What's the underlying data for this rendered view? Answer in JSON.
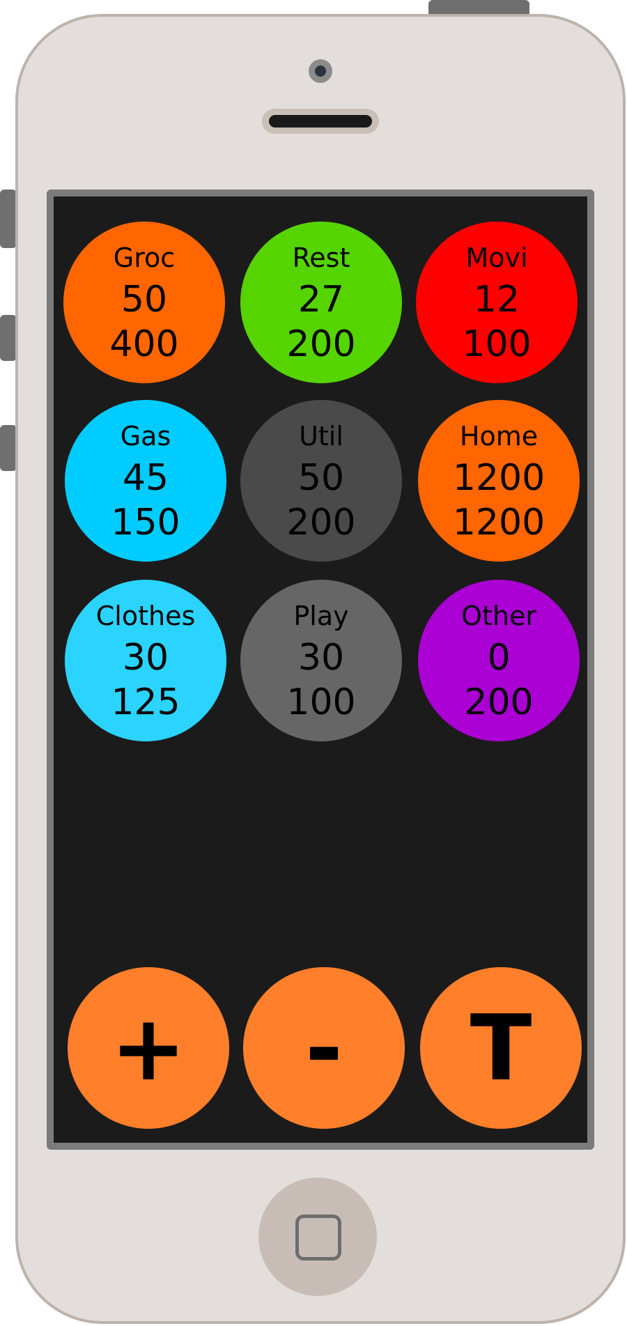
{
  "categories": [
    {
      "label": "Groc",
      "spent": "50",
      "budget": "400",
      "color": "#ff6600"
    },
    {
      "label": "Rest",
      "spent": "27",
      "budget": "200",
      "color": "#55d400"
    },
    {
      "label": "Movi",
      "spent": "12",
      "budget": "100",
      "color": "#ff0000"
    },
    {
      "label": "Gas",
      "spent": "45",
      "budget": "150",
      "color": "#00ccff"
    },
    {
      "label": "Util",
      "spent": "50",
      "budget": "200",
      "color": "#4a4a4a"
    },
    {
      "label": "Home",
      "spent": "1200",
      "budget": "1200",
      "color": "#ff6600"
    },
    {
      "label": "Clothes",
      "spent": "30",
      "budget": "125",
      "color": "#2ad4ff"
    },
    {
      "label": "Play",
      "spent": "30",
      "budget": "100",
      "color": "#666666"
    },
    {
      "label": "Other",
      "spent": "0",
      "budget": "200",
      "color": "#aa00d4"
    }
  ],
  "actions": {
    "add_label": "+",
    "subtract_label": "-",
    "total_label": "T",
    "color": "#ff7f2a"
  },
  "icons": {
    "camera": "camera-icon",
    "speaker": "speaker-icon",
    "home": "home-button-icon"
  }
}
